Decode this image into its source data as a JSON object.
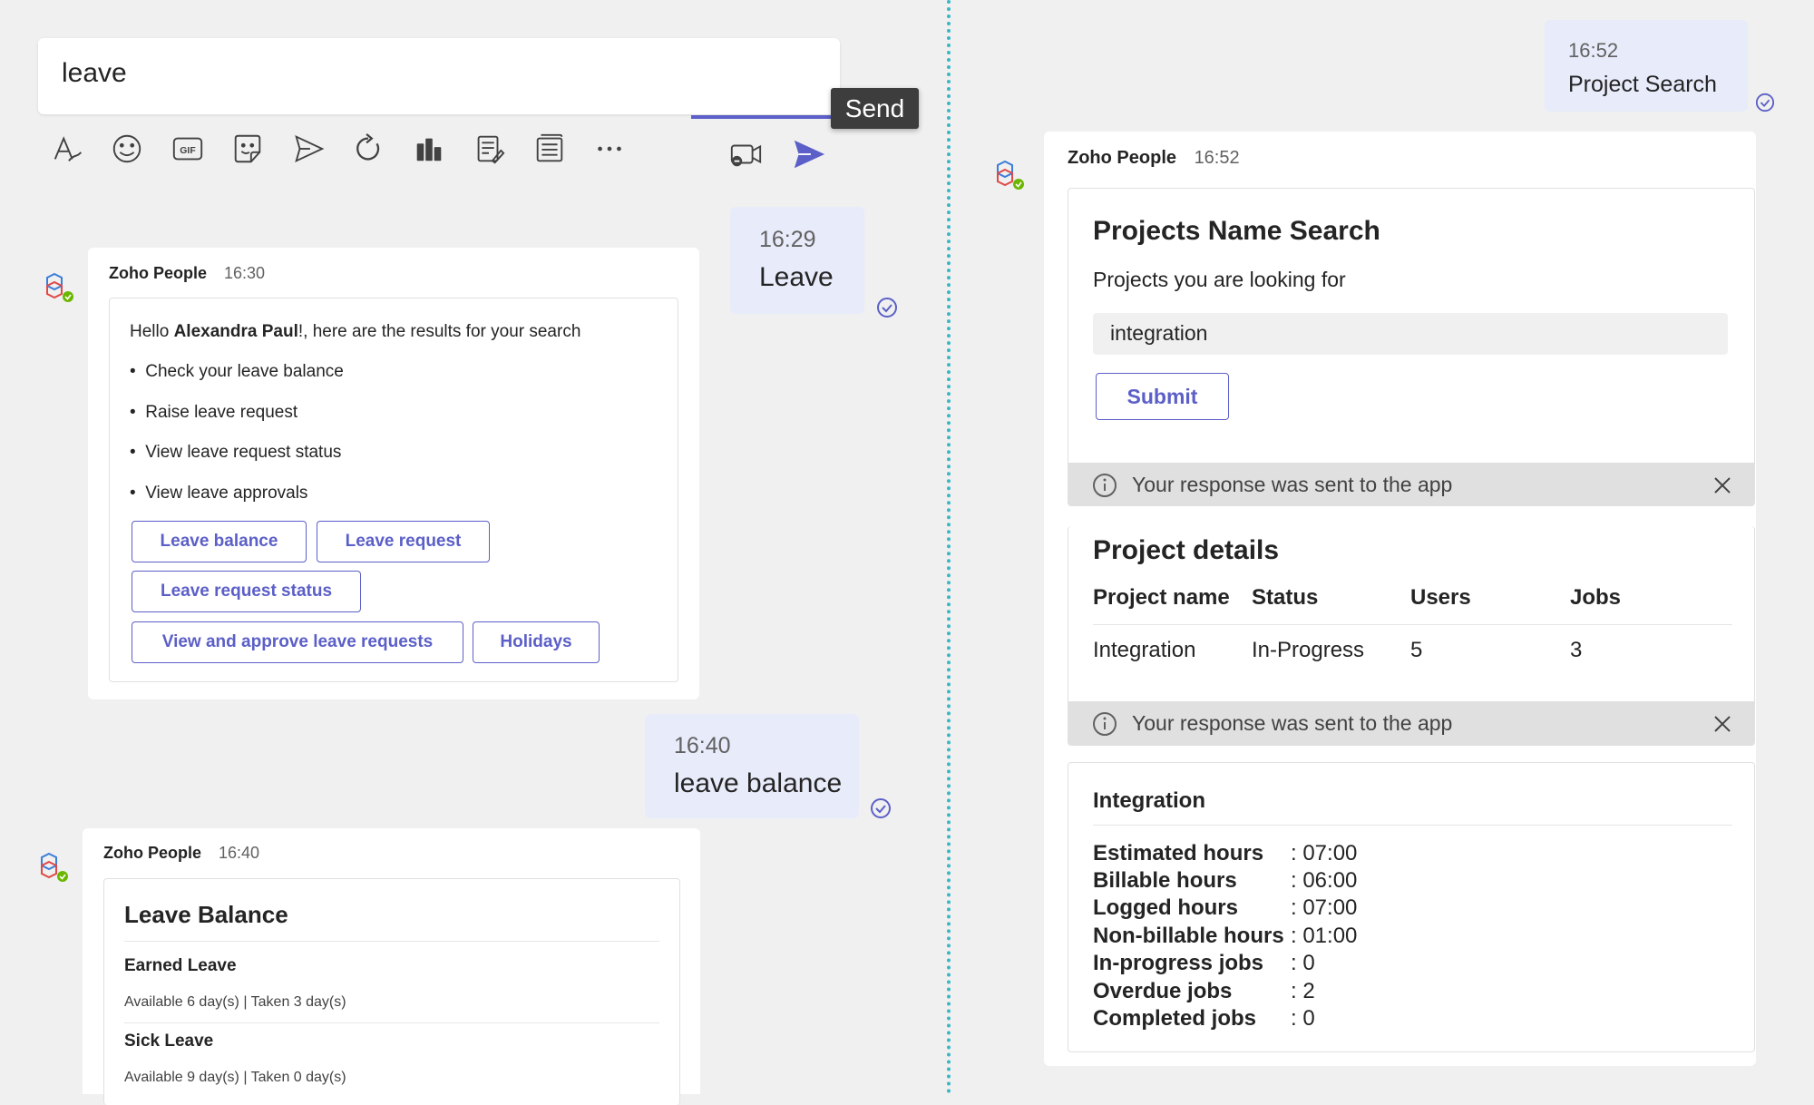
{
  "compose": {
    "text": "leave",
    "tooltip": "Send"
  },
  "toolbar_icons": [
    "format-icon",
    "emoji-icon",
    "gif-icon",
    "sticker-icon",
    "schedule-send-icon",
    "loop-icon",
    "apps-icon",
    "notes-icon",
    "forms-icon",
    "more-icon",
    "video-clip-icon",
    "send-icon"
  ],
  "messages_left": {
    "m1": {
      "time": "16:29",
      "text": "Leave"
    },
    "bot1": {
      "sender": "Zoho People",
      "time": "16:30",
      "greeting_pre": "Hello ",
      "greeting_name": "Alexandra Paul",
      "greeting_post": "!, here are the results for your search",
      "bullets": [
        "Check your leave balance",
        "Raise leave request",
        "View leave request status",
        "View leave approvals"
      ],
      "buttons": [
        "Leave balance",
        "Leave request",
        "Leave request status",
        "View and approve leave requests",
        "Holidays"
      ]
    },
    "m2": {
      "time": "16:40",
      "text": "leave balance"
    },
    "bot2": {
      "sender": "Zoho People",
      "time": "16:40",
      "title": "Leave Balance",
      "items": [
        {
          "name": "Earned Leave",
          "detail": "Available 6 day(s) | Taken 3 day(s)"
        },
        {
          "name": "Sick Leave",
          "detail": "Available 9 day(s) | Taken 0 day(s)"
        }
      ]
    }
  },
  "messages_right": {
    "m1": {
      "time": "16:52",
      "text": "Project Search"
    },
    "bot": {
      "sender": "Zoho People",
      "time": "16:52",
      "search_card": {
        "title": "Projects Name Search",
        "label": "Projects you are looking for",
        "input_value": "integration",
        "submit": "Submit",
        "sent_notice": "Your response was sent to the app"
      },
      "details_card": {
        "title": "Project details",
        "headers": [
          "Project name",
          "Status",
          "Users",
          "Jobs"
        ],
        "row": [
          "Integration",
          "In-Progress",
          "5",
          "3"
        ],
        "sent_notice": "Your response was sent to the app"
      },
      "summary_card": {
        "title": "Integration",
        "rows": [
          {
            "label": "Estimated hours",
            "value": ": 07:00"
          },
          {
            "label": "Billable hours",
            "value": ": 06:00"
          },
          {
            "label": "Logged hours",
            "value": ": 07:00"
          },
          {
            "label": "Non-billable hours",
            "value": ": 01:00"
          },
          {
            "label": "In-progress jobs",
            "value": ": 0"
          },
          {
            "label": "Overdue jobs",
            "value": ": 2"
          },
          {
            "label": "Completed jobs",
            "value": ": 0"
          }
        ]
      }
    }
  },
  "colors": {
    "accent": "#5b5fc7",
    "bubble": "#e8ebfa",
    "divider": "#3bb6c4",
    "presence": "#6bb700"
  }
}
